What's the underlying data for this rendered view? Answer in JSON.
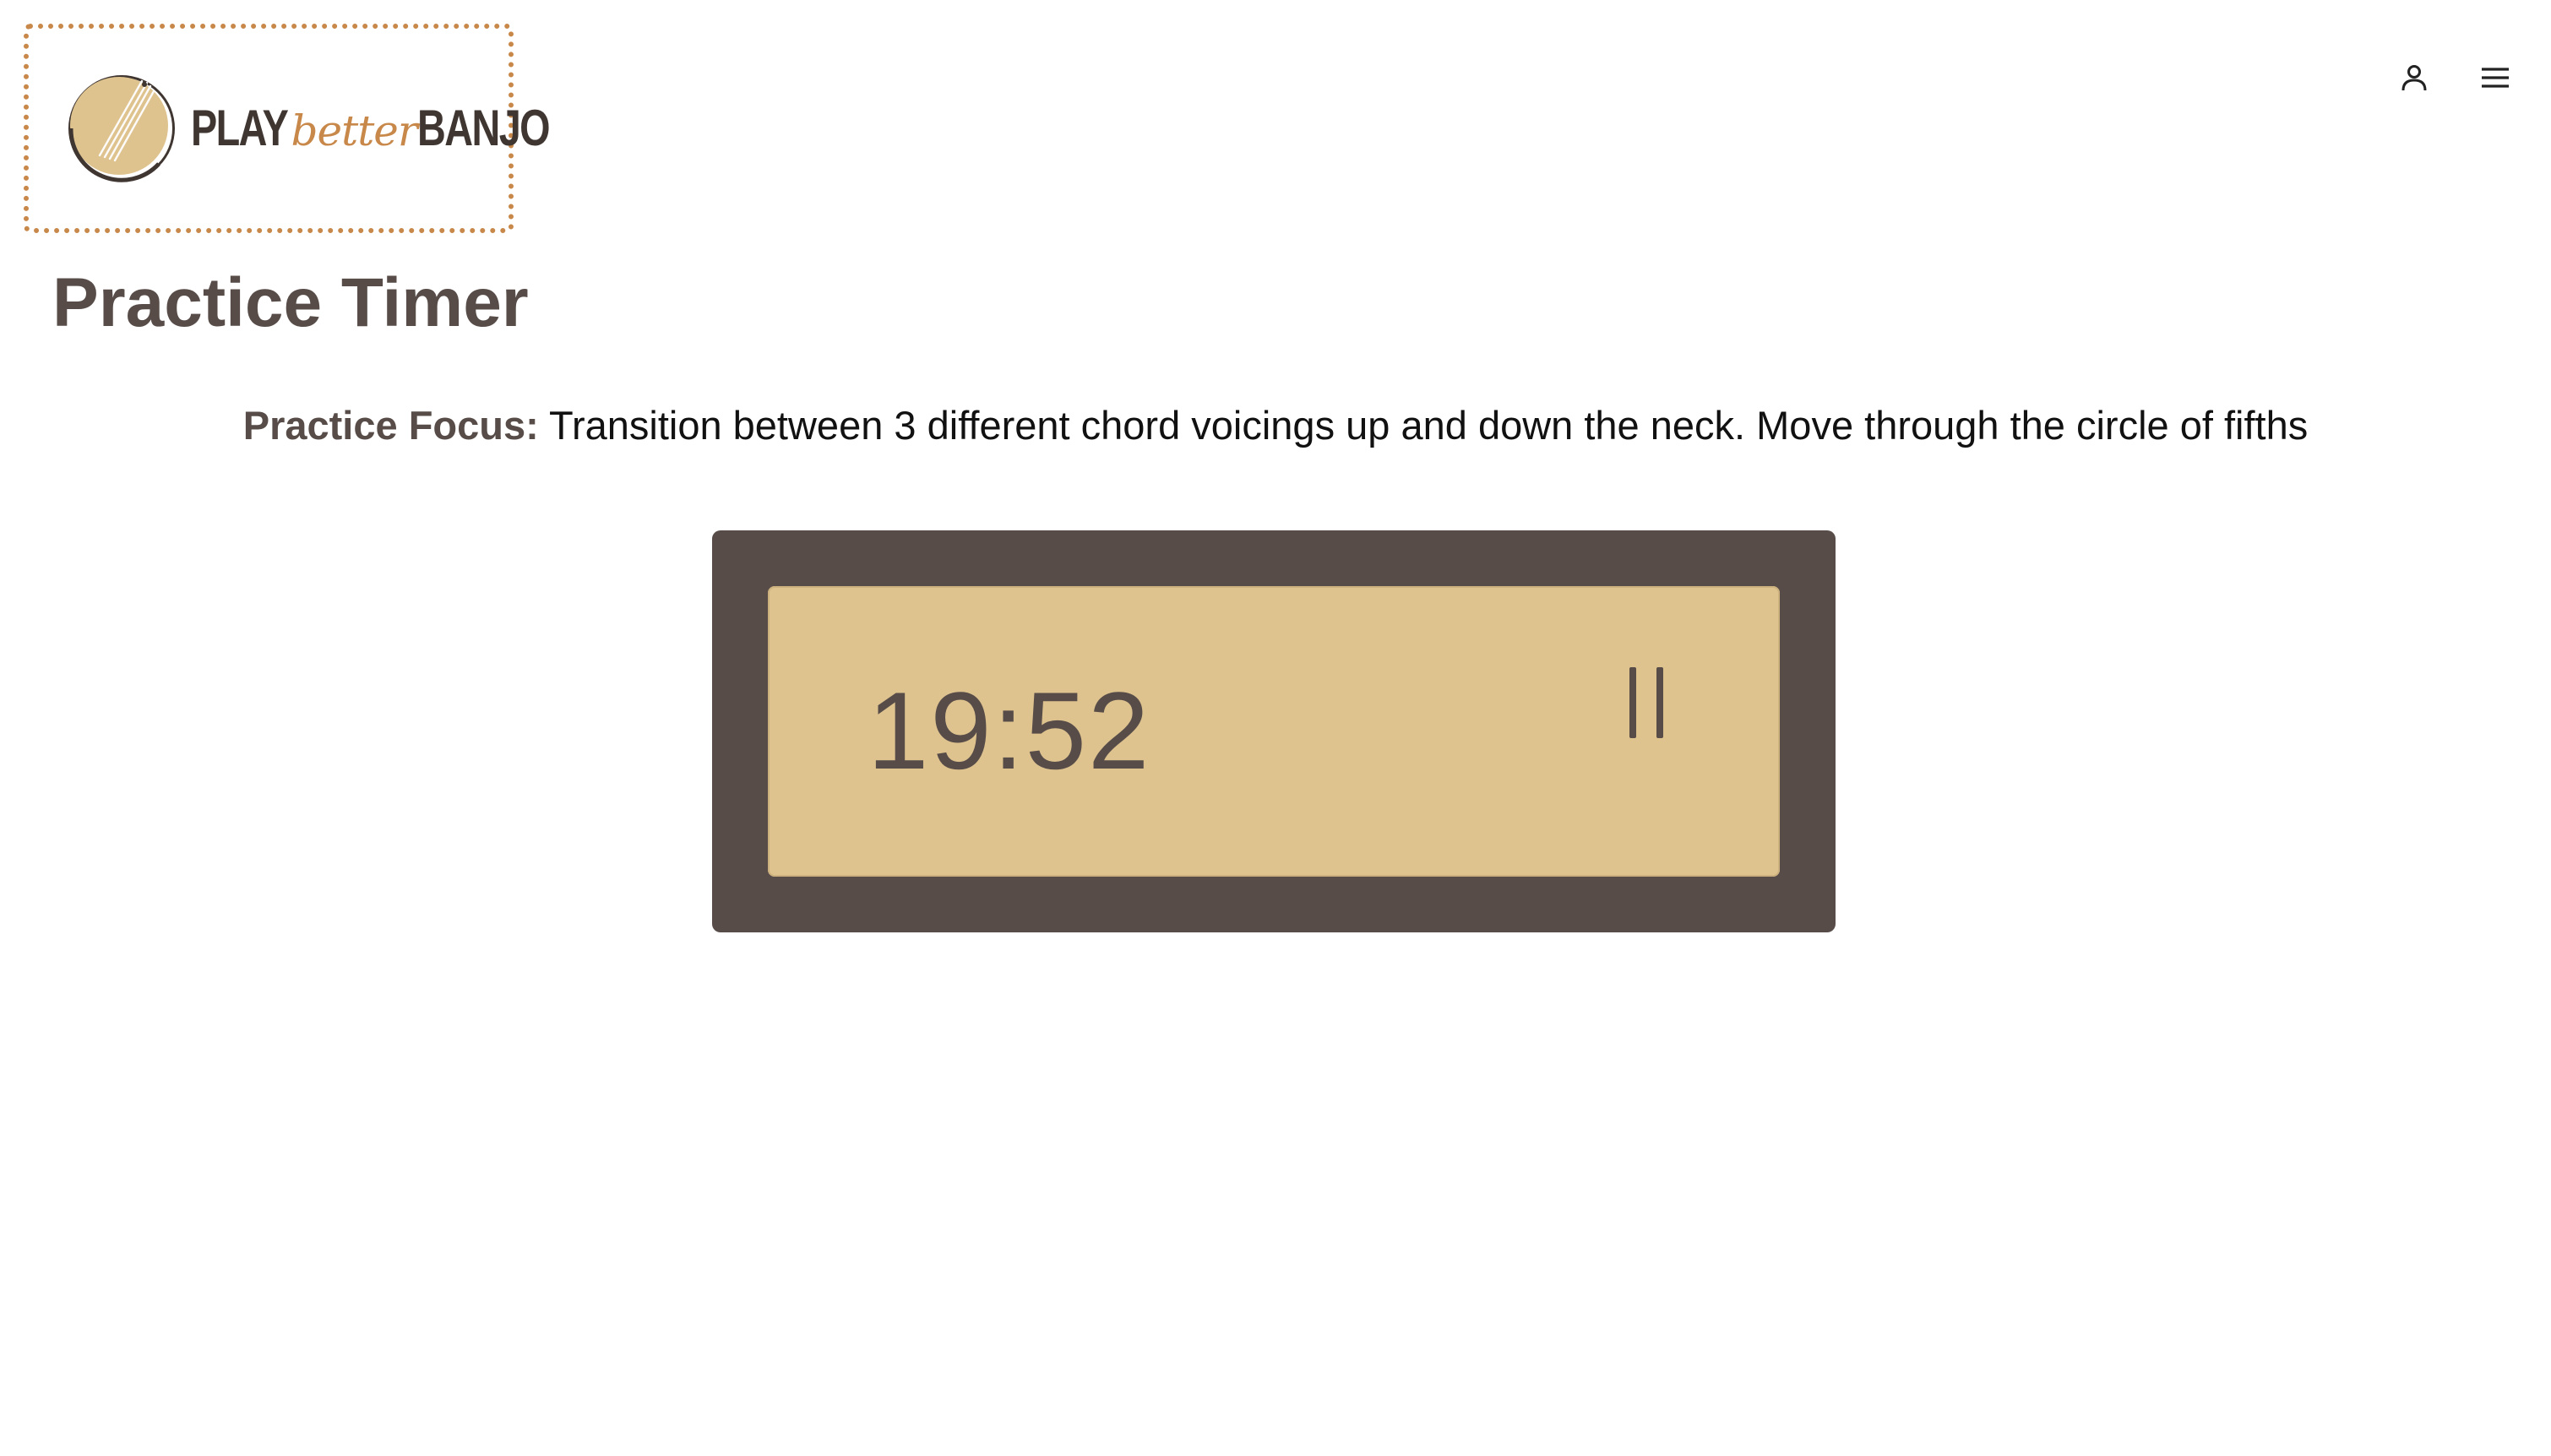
{
  "header": {
    "logo": {
      "play": "PLAY",
      "better": "better",
      "banjo": "BANJO"
    },
    "icons": [
      "user-icon",
      "menu-icon"
    ]
  },
  "main": {
    "title": "Practice Timer",
    "focus_label": "Practice Focus:",
    "focus_text": "Transition between 3 different chord voicings up and down the neck. Move through the circle of fifths",
    "timer": {
      "time": "19:52",
      "state": "running",
      "control_icon": "pause-icon"
    }
  },
  "colors": {
    "brand_dark": "#574c48",
    "brand_gold": "#dec38f",
    "brand_accent": "#c8884a"
  }
}
